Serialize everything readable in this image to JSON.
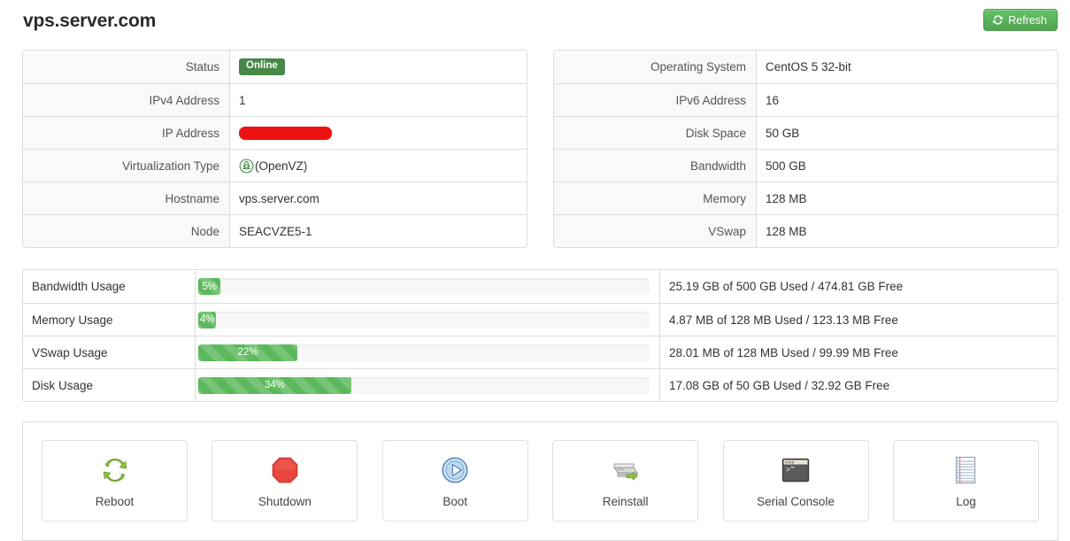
{
  "header": {
    "title": "vps.server.com",
    "refresh_label": "Refresh",
    "refresh_icon": "refresh-icon",
    "accent_color": "#51a351"
  },
  "info_left": {
    "rows": [
      {
        "label": "Status",
        "value": "Online",
        "type": "badge",
        "icon": ""
      },
      {
        "label": "IPv4 Address",
        "value": "1",
        "type": "text",
        "icon": ""
      },
      {
        "label": "IP Address",
        "value": "",
        "type": "redacted",
        "icon": ""
      },
      {
        "label": "Virtualization Type",
        "value": "(OpenVZ)",
        "type": "icon-text",
        "icon": "openvz-icon"
      },
      {
        "label": "Hostname",
        "value": "vps.server.com",
        "type": "text",
        "icon": ""
      },
      {
        "label": "Node",
        "value": "SEACVZE5-1",
        "type": "text",
        "icon": ""
      }
    ]
  },
  "info_right": {
    "rows": [
      {
        "label": "Operating System",
        "value": "CentOS 5 32-bit",
        "type": "text",
        "icon": ""
      },
      {
        "label": "IPv6 Address",
        "value": "16",
        "type": "text",
        "icon": ""
      },
      {
        "label": "Disk Space",
        "value": "50 GB",
        "type": "text",
        "icon": ""
      },
      {
        "label": "Bandwidth",
        "value": "500 GB",
        "type": "text",
        "icon": ""
      },
      {
        "label": "Memory",
        "value": "128 MB",
        "type": "text",
        "icon": ""
      },
      {
        "label": "VSwap",
        "value": "128 MB",
        "type": "text",
        "icon": ""
      }
    ]
  },
  "usage": {
    "bar_color": "#5cb85c",
    "rows": [
      {
        "name": "Bandwidth Usage",
        "percent": 5,
        "percent_label": "5%",
        "detail": "25.19 GB of 500 GB Used / 474.81 GB Free"
      },
      {
        "name": "Memory Usage",
        "percent": 4,
        "percent_label": "4%",
        "detail": "4.87 MB of 128 MB Used / 123.13 MB Free"
      },
      {
        "name": "VSwap Usage",
        "percent": 22,
        "percent_label": "22%",
        "detail": "28.01 MB of 128 MB Used / 99.99 MB Free"
      },
      {
        "name": "Disk Usage",
        "percent": 34,
        "percent_label": "34%",
        "detail": "17.08 GB of 50 GB Used / 32.92 GB Free"
      }
    ]
  },
  "actions": {
    "buttons": [
      {
        "label": "Reboot",
        "icon": "reboot-icon"
      },
      {
        "label": "Shutdown",
        "icon": "shutdown-icon"
      },
      {
        "label": "Boot",
        "icon": "boot-icon"
      },
      {
        "label": "Reinstall",
        "icon": "reinstall-icon"
      },
      {
        "label": "Serial Console",
        "icon": "terminal-icon"
      },
      {
        "label": "Log",
        "icon": "log-icon"
      }
    ]
  }
}
